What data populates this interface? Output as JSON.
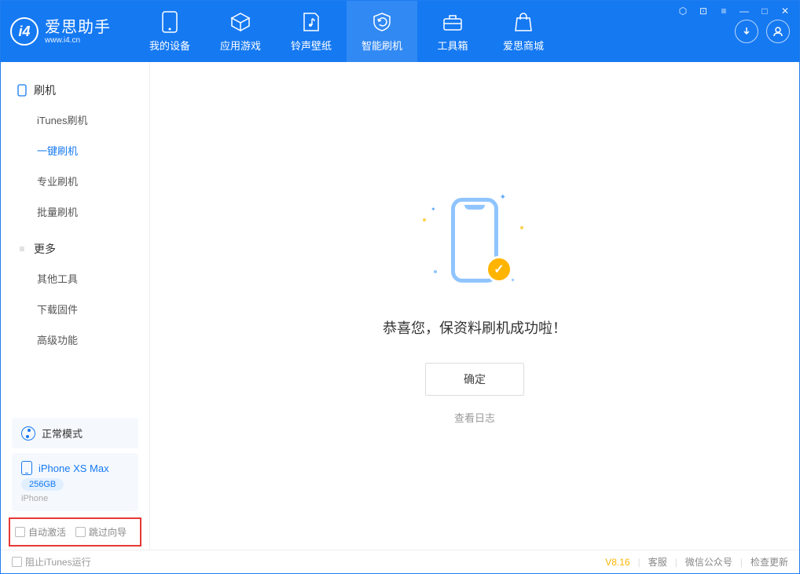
{
  "app": {
    "name_cn": "爱思助手",
    "name_en": "www.i4.cn"
  },
  "nav": {
    "items": [
      {
        "label": "我的设备"
      },
      {
        "label": "应用游戏"
      },
      {
        "label": "铃声壁纸"
      },
      {
        "label": "智能刷机"
      },
      {
        "label": "工具箱"
      },
      {
        "label": "爱思商城"
      }
    ],
    "active_index": 3
  },
  "sidebar": {
    "group1": {
      "title": "刷机",
      "items": [
        {
          "label": "iTunes刷机"
        },
        {
          "label": "一键刷机"
        },
        {
          "label": "专业刷机"
        },
        {
          "label": "批量刷机"
        }
      ],
      "active_index": 1
    },
    "group2": {
      "title": "更多",
      "items": [
        {
          "label": "其他工具"
        },
        {
          "label": "下载固件"
        },
        {
          "label": "高级功能"
        }
      ]
    },
    "mode": "正常模式",
    "device": {
      "name": "iPhone XS Max",
      "storage": "256GB",
      "type": "iPhone"
    },
    "checks": {
      "auto_activate": "自动激活",
      "skip_guide": "跳过向导"
    }
  },
  "main": {
    "success_text": "恭喜您，保资料刷机成功啦！",
    "ok_button": "确定",
    "log_link": "查看日志"
  },
  "footer": {
    "block_itunes": "阻止iTunes运行",
    "version": "V8.16",
    "links": {
      "service": "客服",
      "wechat": "微信公众号",
      "update": "检查更新"
    }
  }
}
